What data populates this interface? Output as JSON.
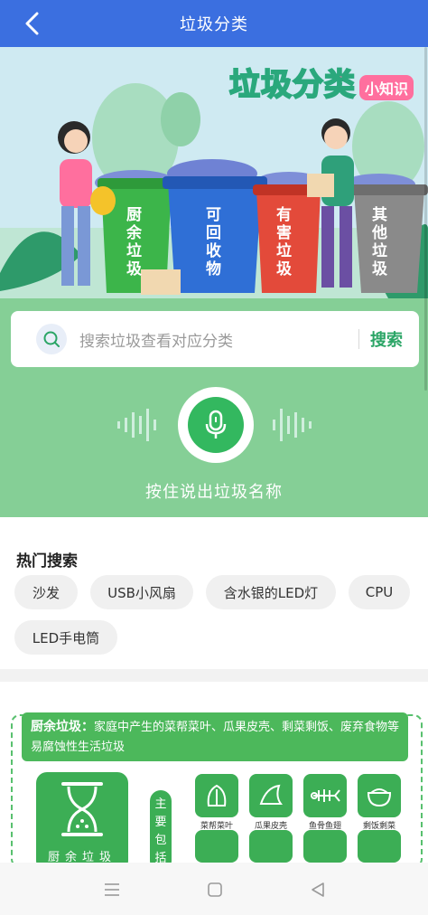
{
  "header": {
    "title": "垃圾分类"
  },
  "banner": {
    "title_big": "垃圾分类",
    "title_small": "小知识",
    "bins": [
      {
        "label": "厨余垃圾",
        "color": "#3cb54a"
      },
      {
        "label": "可回收物",
        "color": "#2f6fd6"
      },
      {
        "label": "有害垃圾",
        "color": "#e34a3a"
      },
      {
        "label": "其他垃圾",
        "color": "#8a8a8a"
      }
    ]
  },
  "search": {
    "placeholder": "搜索垃圾查看对应分类",
    "button": "搜索"
  },
  "voice": {
    "hint": "按住说出垃圾名称"
  },
  "hot": {
    "title": "热门搜索",
    "tags": [
      "沙发",
      "USB小风扇",
      "含水银的LED灯",
      "CPU",
      "LED手电筒"
    ]
  },
  "category": {
    "label": "厨余垃圾：",
    "description": "家庭中产生的菜帮菜叶、瓜果皮壳、剩菜剩饭、废弃食物等易腐蚀性生活垃圾",
    "name": "厨余垃圾",
    "includes_label": "主要包括",
    "items": [
      "菜帮菜叶",
      "瓜果皮壳",
      "鱼骨鱼翅",
      "剩饭剩菜"
    ]
  },
  "colors": {
    "accent_blue": "#3b6fe0",
    "accent_green": "#85cf96",
    "brand_green": "#3cae55"
  }
}
